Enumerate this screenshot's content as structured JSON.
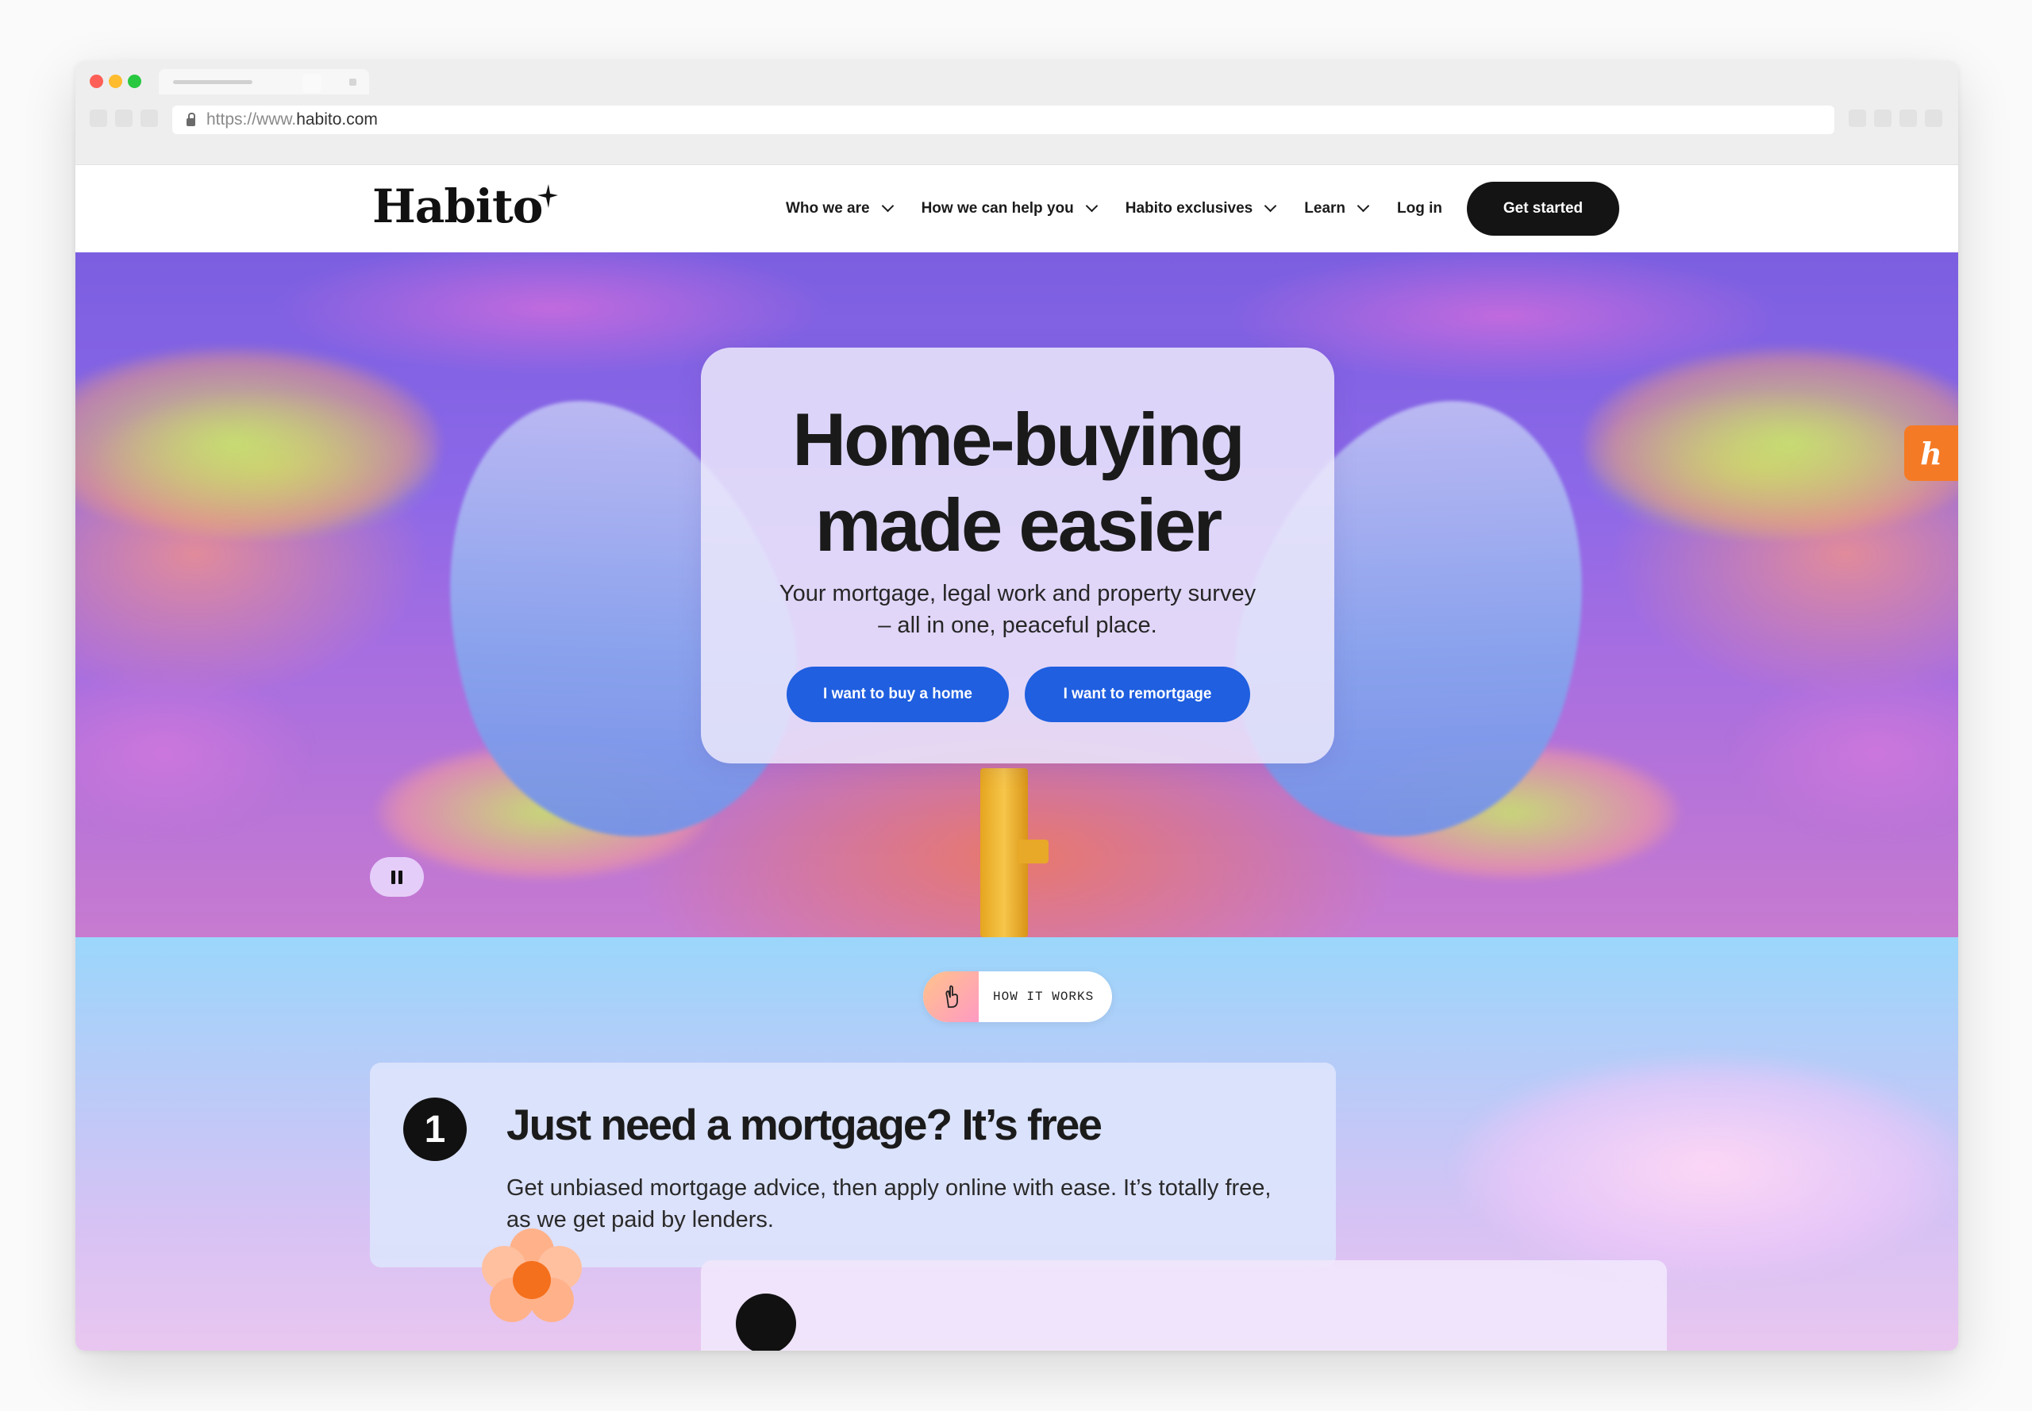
{
  "browser": {
    "url_prefix": "https://www.",
    "url_host": "habito.com"
  },
  "header": {
    "logo": "Habito",
    "nav": [
      {
        "label": "Who we are"
      },
      {
        "label": "How we can help you"
      },
      {
        "label": "Habito exclusives"
      },
      {
        "label": "Learn"
      }
    ],
    "login": "Log in",
    "cta": "Get started"
  },
  "hero": {
    "title_line1": "Home-buying",
    "title_line2": "made easier",
    "subtitle": "Your mortgage, legal work and property survey – all in one, peaceful place.",
    "btn_buy": "I want to buy a home",
    "btn_remortgage": "I want to remortgage",
    "badge_letter": "h"
  },
  "how": {
    "label": "HOW IT WORKS"
  },
  "steps": [
    {
      "number": "1",
      "title": "Just need a mortgage? It’s free",
      "body": "Get unbiased mortgage advice, then apply online with ease. It’s totally free, as we get paid by lenders."
    }
  ],
  "colors": {
    "primary_blue": "#1f5fe0",
    "cta_black": "#141414",
    "badge_orange": "#f57a25"
  }
}
